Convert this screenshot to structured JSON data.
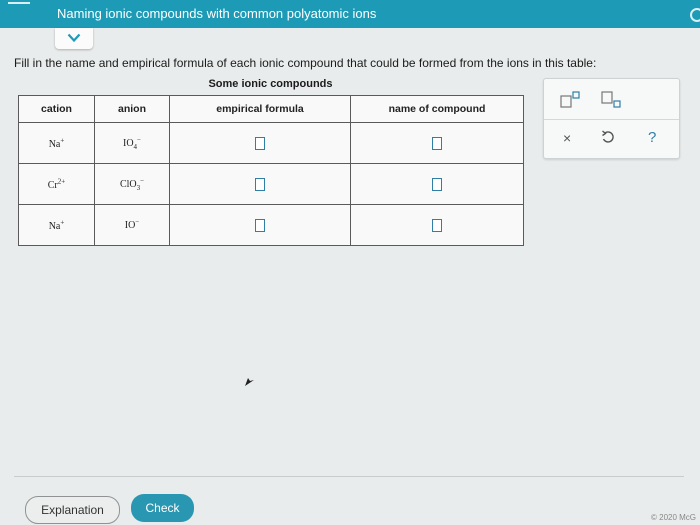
{
  "header": {
    "title": "Naming ionic compounds with common polyatomic ions"
  },
  "instructions": "Fill in the name and empirical formula of each ionic compound that could be formed from the ions in this table:",
  "table": {
    "caption": "Some ionic compounds",
    "headers": [
      "cation",
      "anion",
      "empirical formula",
      "name of compound"
    ],
    "rows": [
      {
        "cation": "Na",
        "cation_charge": "+",
        "anion": "IO",
        "anion_sub": "4",
        "anion_charge": "−"
      },
      {
        "cation": "Cr",
        "cation_charge": "2+",
        "anion": "ClO",
        "anion_sub": "3",
        "anion_charge": "−"
      },
      {
        "cation": "Na",
        "cation_charge": "+",
        "anion": "IO",
        "anion_sub": "",
        "anion_charge": "−"
      }
    ]
  },
  "toolbox": {
    "close_symbol": "×",
    "help_symbol": "?"
  },
  "footer": {
    "explanation_label": "Explanation",
    "check_label": "Check",
    "copyright": "© 2020 McG"
  },
  "colors": {
    "header_bg": "#1c9ab6",
    "accent": "#2a97b2",
    "page_bg": "#e9ecec"
  },
  "icons": [
    "menu-icon",
    "chevron-down-icon",
    "superscript-icon",
    "subscript-icon",
    "close-icon",
    "undo-icon",
    "help-icon",
    "cursor-icon"
  ]
}
